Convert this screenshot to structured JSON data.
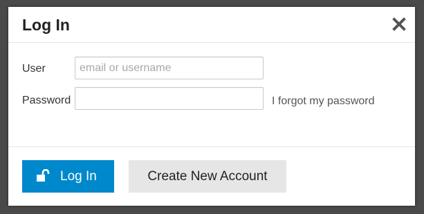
{
  "dialog": {
    "title": "Log In"
  },
  "form": {
    "user_label": "User",
    "user_placeholder": "email or username",
    "user_value": "",
    "password_label": "Password",
    "password_value": "",
    "forgot_link": "I forgot my password"
  },
  "footer": {
    "login_label": "Log In",
    "create_account_label": "Create New Account"
  },
  "icons": {
    "close": "close-icon",
    "login": "unlock-icon"
  },
  "colors": {
    "primary": "#0088cc",
    "secondary_button": "#e6e6e6",
    "backdrop": "#4a4a4a"
  }
}
